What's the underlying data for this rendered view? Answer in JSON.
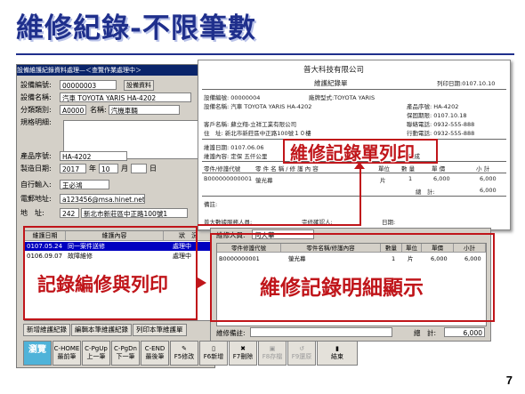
{
  "slide": {
    "title": "維修紀錄-不限筆數",
    "page_number": "7"
  },
  "window": {
    "title": "設備維護紀錄資料處理—＜查覽作業處理中＞",
    "fields": {
      "device_no_label": "設備編號:",
      "device_no": "00000003",
      "device_btn": "設備資料",
      "device_name_label": "設備名稱:",
      "device_name": "汽車 TOYOTA YARIS HA-4202",
      "category_label": "分類類別:",
      "category_code": "A0000",
      "category_name_label": "名稱:",
      "category_name": "汽機車輛",
      "spec_label": "規格明細:",
      "serial_label": "產品序號:",
      "serial": "HA-4202",
      "mfg_label": "製造日期:",
      "mfg_year": "2017",
      "year_unit": "年",
      "mfg_month": "10",
      "month_unit": "月",
      "day_unit": "日",
      "input_label": "自行輸入:",
      "input_value": "王必鴻",
      "email_label": "電郵地址:",
      "email_value": "a123456@msa.hinet.net",
      "addr_label": "地　址:",
      "zip": "242",
      "addr_value": "新北市新莊區中正路100號1"
    },
    "grid": {
      "headers": [
        "維護日期",
        "維護內容",
        "狀　況"
      ],
      "rows": [
        {
          "date": "0107.05.24",
          "content": "同一案件送修",
          "status": "處理中"
        },
        {
          "date": "0106.09.07",
          "content": "故障維修",
          "status": "處理中"
        }
      ]
    },
    "tabs": [
      "新增維護紀錄",
      "編輯本筆維護紀錄",
      "列印本筆維護單"
    ],
    "toolbar": [
      {
        "top": "瀏覽",
        "bottom": ""
      },
      {
        "top": "C-HOME",
        "bottom": "最前筆"
      },
      {
        "top": "C-PgUp",
        "bottom": "上一筆"
      },
      {
        "top": "C-PgDn",
        "bottom": "下一筆"
      },
      {
        "top": "C-END",
        "bottom": "最後筆"
      },
      {
        "top": "",
        "bottom": "F5修改"
      },
      {
        "top": "",
        "bottom": "F6新增"
      },
      {
        "top": "",
        "bottom": "F7刪除"
      },
      {
        "top": "",
        "bottom": "F8存檔"
      },
      {
        "top": "",
        "bottom": "F9還原"
      },
      {
        "top": "",
        "bottom": "結束"
      }
    ]
  },
  "document": {
    "company": "普大科技有限公司",
    "doc_title": "維護紀錄單",
    "print_date": "列印日期:0107.10.10",
    "device_no": "設備編號: 00000004",
    "model": "廠牌型式:TOYOTA YARIS",
    "device_name": "設備名稱: 汽車 TOYOTA YARIS HA-4202",
    "serial": "產品序號: HA-4202",
    "warranty": "保固期限: 0107.10.18",
    "client": "客戶名稱: 蘇立翔-立祥工業有限公司",
    "address": "住　址: 新北市新莊區中正路100號１０樓",
    "tel": "聯絡電話: 0932-555-888",
    "mobile": "行動電話: 0932-555-888",
    "repair_date": "維護日期: 0107.06.06",
    "repair_content": "維護內容: 定保 五仟公里",
    "status": "完成",
    "item_headers": [
      "零件/修護代號",
      "零 件 名 稱 / 修 護 內 容",
      "單位",
      "數 量",
      "單 價",
      "小 計"
    ],
    "item": {
      "code": "B000000000001",
      "name": "螢光幕",
      "unit": "片",
      "qty": "1",
      "price": "6,000",
      "subtotal": "6,000"
    },
    "total_label": "總　計:",
    "total": "6,000",
    "remark_label": "備註:",
    "person_label": "普大數據服務人員:",
    "confirm_label": "完修確認人:",
    "date_label": "日期:"
  },
  "detail": {
    "person_label": "維修人員:",
    "person_value": "何大華",
    "headers": [
      "零件修護代號",
      "零件名稱/修護內容",
      "數量",
      "單位",
      "單價",
      "小計"
    ],
    "row": {
      "code": "B0000000001",
      "name": "螢光幕",
      "qty": "1",
      "unit": "片",
      "price": "6,000",
      "subtotal": "6,000"
    },
    "remark_label": "維修備註:",
    "total_label": "總　計:",
    "total": "6,000"
  },
  "annotations": {
    "print_label": "維修記錄單列印",
    "edit_label": "記錄編修與列印",
    "detail_label": "維修記錄明細顯示"
  },
  "colors": {
    "title": "#1f2f8c",
    "annotation": "#c0151a",
    "highlight_row": "#0000c0",
    "browse_button": "#4fb3d9"
  }
}
